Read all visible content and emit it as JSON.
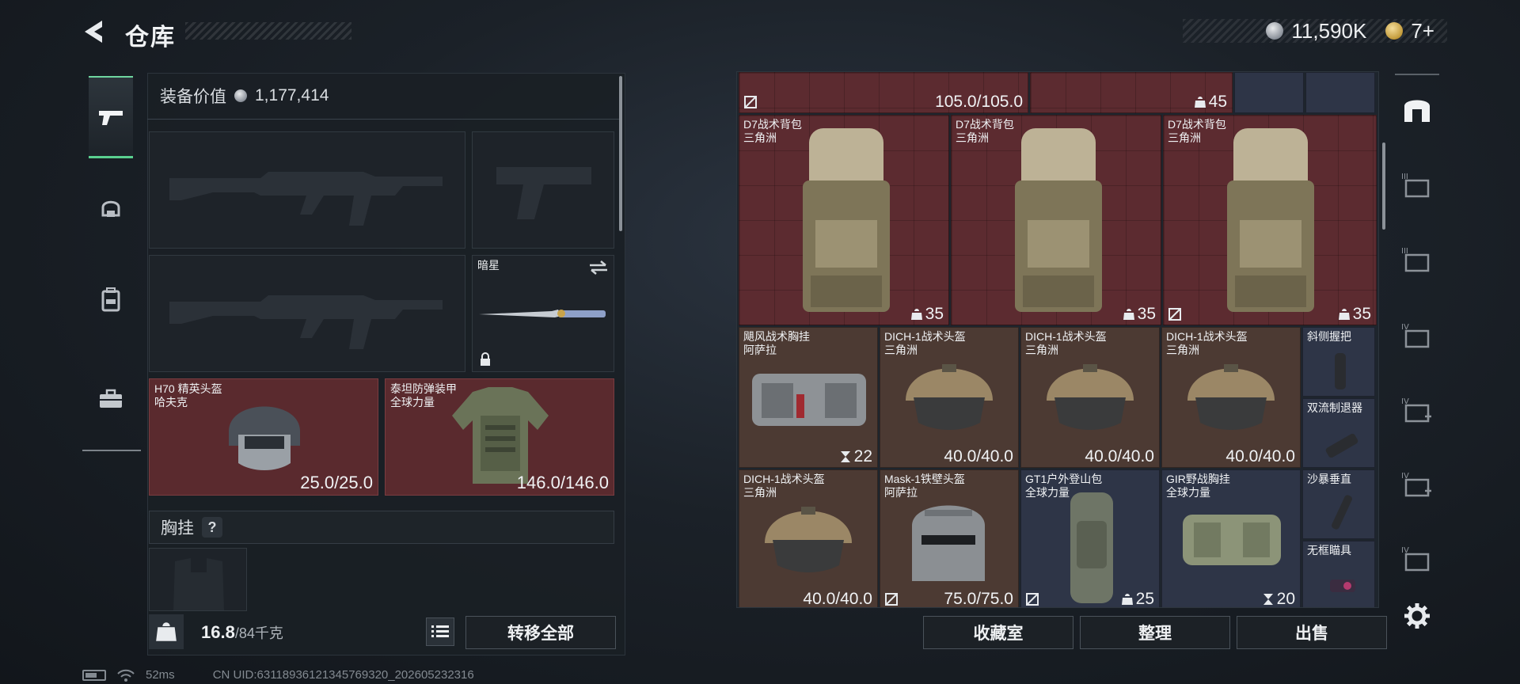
{
  "header": {
    "title": "仓库",
    "currency_silver": "11,590K",
    "currency_gold": "7+"
  },
  "equipment": {
    "value_label": "装备价值",
    "value": "1,177,414",
    "melee": {
      "name": "暗星"
    },
    "helmet": {
      "name": "H70 精英头盔",
      "brand": "哈夫克",
      "durability": "25.0/25.0"
    },
    "armor": {
      "name": "泰坦防弹装甲",
      "brand": "全球力量",
      "durability": "146.0/146.0"
    },
    "chest_rig_label": "胸挂",
    "chest_rig_help": "?",
    "weight_current": "16.8",
    "weight_max": "/84千克",
    "transfer_all": "转移全部"
  },
  "storage": {
    "top_row": [
      {
        "stat": "105.0/105.0"
      },
      {
        "stat": "45"
      }
    ],
    "items": [
      {
        "name": "D7战术背包",
        "brand": "三角洲",
        "stat": "35"
      },
      {
        "name": "D7战术背包",
        "brand": "三角洲",
        "stat": "35"
      },
      {
        "name": "D7战术背包",
        "brand": "三角洲",
        "stat": "35"
      },
      {
        "name": "飓风战术胸挂",
        "brand": "阿萨拉",
        "stat": "22"
      },
      {
        "name": "DICH-1战术头盔",
        "brand": "三角洲",
        "stat": "40.0/40.0"
      },
      {
        "name": "DICH-1战术头盔",
        "brand": "三角洲",
        "stat": "40.0/40.0"
      },
      {
        "name": "DICH-1战术头盔",
        "brand": "三角洲",
        "stat": "40.0/40.0"
      },
      {
        "name": "斜侧握把",
        "brand": "",
        "stat": ""
      },
      {
        "name": "双流制退器",
        "brand": "",
        "stat": ""
      },
      {
        "name": "DICH-1战术头盔",
        "brand": "三角洲",
        "stat": "40.0/40.0"
      },
      {
        "name": "Mask-1铁壁头盔",
        "brand": "阿萨拉",
        "stat": "75.0/75.0"
      },
      {
        "name": "GT1户外登山包",
        "brand": "全球力量",
        "stat": "25"
      },
      {
        "name": "GIR野战胸挂",
        "brand": "全球力量",
        "stat": "20"
      },
      {
        "name": "沙暴垂直",
        "brand": "",
        "stat": ""
      },
      {
        "name": "无框瞄具",
        "brand": "",
        "stat": ""
      }
    ]
  },
  "bottom_buttons": {
    "collection": "收藏室",
    "organize": "整理",
    "sell": "出售"
  },
  "status": {
    "ping": "52ms",
    "uid": "CN UID:63118936121345769320_202605232316"
  },
  "colors": {
    "red_cell": "#5c2b30",
    "brown_cell": "#4c3a33",
    "navy_cell": "#2e3547",
    "active_tab_accent": "#5ad08f"
  }
}
